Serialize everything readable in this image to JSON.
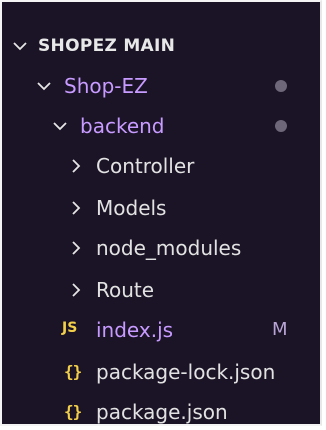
{
  "explorer": {
    "workspace_title": "SHOPEZ MAIN",
    "items": [
      {
        "label": "Shop-EZ",
        "kind": "folder",
        "expanded": true,
        "status": "dot"
      },
      {
        "label": "backend",
        "kind": "folder",
        "expanded": true,
        "status": "dot"
      },
      {
        "label": "Controller",
        "kind": "folder",
        "expanded": false
      },
      {
        "label": "Models",
        "kind": "folder",
        "expanded": false
      },
      {
        "label": "node_modules",
        "kind": "folder",
        "expanded": false
      },
      {
        "label": "Route",
        "kind": "folder",
        "expanded": false
      },
      {
        "label": "index.js",
        "kind": "file",
        "icon_text": "JS",
        "status": "M"
      },
      {
        "label": "package-lock.json",
        "kind": "file",
        "icon_text": "{}"
      },
      {
        "label": "package.json",
        "kind": "file",
        "icon_text": "{}"
      }
    ]
  },
  "colors": {
    "background": "#1b1326",
    "modified_text": "#c79bff",
    "json_js_icon": "#f3d04a",
    "status_dot": "#6e6679"
  }
}
